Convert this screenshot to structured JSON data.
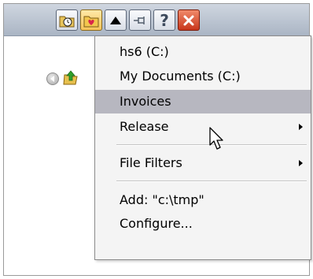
{
  "titlebar": {
    "buttons": [
      {
        "name": "clock-folder-icon"
      },
      {
        "name": "favorites-folder-icon"
      },
      {
        "name": "up-arrow-icon"
      },
      {
        "name": "pin-icon"
      },
      {
        "name": "help-icon",
        "label": "?"
      },
      {
        "name": "close-icon"
      }
    ]
  },
  "left_pane": {
    "icons": [
      "back-icon",
      "folder-up-icon"
    ]
  },
  "menu": {
    "items": [
      {
        "label": "hs6  (C:)"
      },
      {
        "label": "My Documents  (C:)"
      },
      {
        "label": "Invoices",
        "highlighted": true
      },
      {
        "label": "Release",
        "submenu": true
      },
      {
        "label": "File Filters",
        "submenu": true
      },
      {
        "label": "Add: \"c:\\tmp\""
      },
      {
        "label": "Configure..."
      }
    ]
  },
  "colors": {
    "highlight": "#b7b7c0",
    "menu_bg": "#f4f4f4",
    "close_button": "#d9492a",
    "active_button": "#f5c45a"
  }
}
